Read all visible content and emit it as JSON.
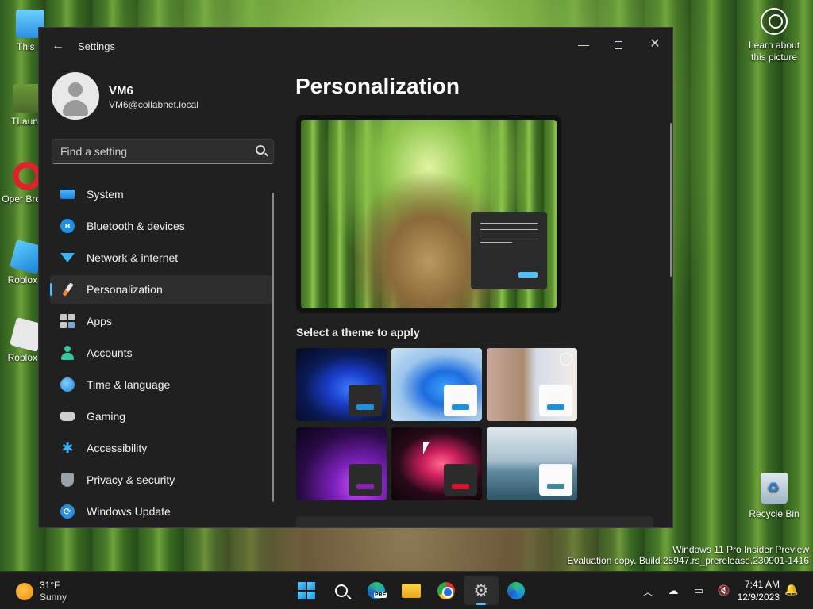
{
  "desktop": {
    "icons": [
      {
        "label": "This P"
      },
      {
        "label": "TLaunc"
      },
      {
        "label": "Oper Brows"
      },
      {
        "label": "Roblox S"
      },
      {
        "label": "Roblox P"
      }
    ],
    "learn_about": "Learn about this picture",
    "recycle_bin": "Recycle Bin",
    "watermark_line1": "Windows 11 Pro Insider Preview",
    "watermark_line2": "Evaluation copy. Build 25947.rs_prerelease.230901-1416"
  },
  "window": {
    "title": "Settings",
    "controls": {
      "minimize": "—",
      "close": "✕"
    },
    "colors": {
      "accent": "#4cc2ff",
      "background": "#202020"
    }
  },
  "profile": {
    "name": "VM6",
    "email": "VM6@collabnet.local"
  },
  "search": {
    "placeholder": "Find a setting"
  },
  "nav": {
    "items": [
      {
        "label": "System",
        "icon": "monitor-icon"
      },
      {
        "label": "Bluetooth & devices",
        "icon": "bluetooth-icon"
      },
      {
        "label": "Network & internet",
        "icon": "wifi-icon"
      },
      {
        "label": "Personalization",
        "icon": "brush-icon",
        "active": true
      },
      {
        "label": "Apps",
        "icon": "apps-icon"
      },
      {
        "label": "Accounts",
        "icon": "person-icon"
      },
      {
        "label": "Time & language",
        "icon": "globe-clock-icon"
      },
      {
        "label": "Gaming",
        "icon": "gamepad-icon"
      },
      {
        "label": "Accessibility",
        "icon": "accessibility-icon"
      },
      {
        "label": "Privacy & security",
        "icon": "shield-icon"
      },
      {
        "label": "Windows Update",
        "icon": "update-icon"
      }
    ]
  },
  "content": {
    "title": "Personalization",
    "themes_label": "Select a theme to apply",
    "themes": [
      {
        "name": "windows-dark-theme"
      },
      {
        "name": "windows-light-theme"
      },
      {
        "name": "spotlight-theme"
      },
      {
        "name": "glow-theme"
      },
      {
        "name": "captured-motion-theme"
      },
      {
        "name": "flow-theme"
      }
    ]
  },
  "taskbar": {
    "weather_temp": "31°F",
    "weather_cond": "Sunny",
    "time": "7:41 AM",
    "date": "12/9/2023",
    "apps": [
      "start",
      "search",
      "edge-preview",
      "file-explorer",
      "chrome",
      "settings",
      "edge"
    ]
  }
}
